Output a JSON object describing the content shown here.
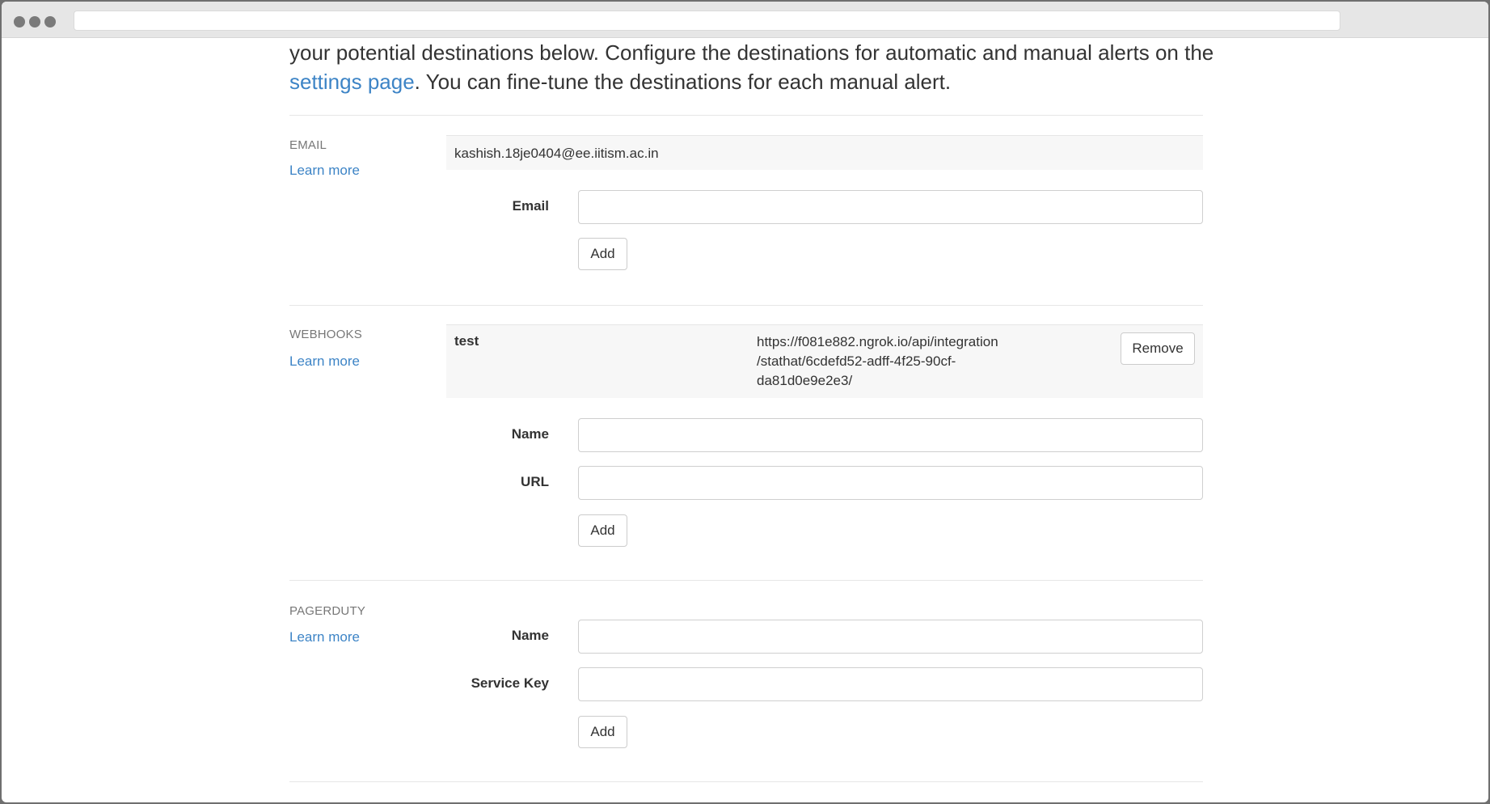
{
  "intro": {
    "line1": "your potential destinations below. Configure the destinations for automatic and manual alerts on the",
    "link_text": "settings page",
    "line2_rest": ". You can fine-tune the destinations for each manual alert."
  },
  "email": {
    "title": "EMAIL",
    "learn_more": "Learn more",
    "existing_value": "kashish.18je0404@ee.iitism.ac.in",
    "field_label": "Email",
    "field_value": "",
    "add_label": "Add"
  },
  "webhooks": {
    "title": "WEBHOOKS",
    "learn_more": "Learn more",
    "existing": {
      "name": "test",
      "url_line1": "https://f081e882.ngrok.io/api/integration",
      "url_line2": "/stathat/6cdefd52-adff-4f25-90cf-",
      "url_line3": "da81d0e9e2e3/",
      "remove_label": "Remove"
    },
    "name_label": "Name",
    "url_label": "URL",
    "add_label": "Add"
  },
  "pagerduty": {
    "title": "PAGERDUTY",
    "learn_more": "Learn more",
    "name_label": "Name",
    "service_key_label": "Service Key",
    "add_label": "Add"
  },
  "colors": {
    "link": "#3d84c6",
    "text": "#333333",
    "muted": "#777777",
    "panel": "#f7f7f7"
  }
}
